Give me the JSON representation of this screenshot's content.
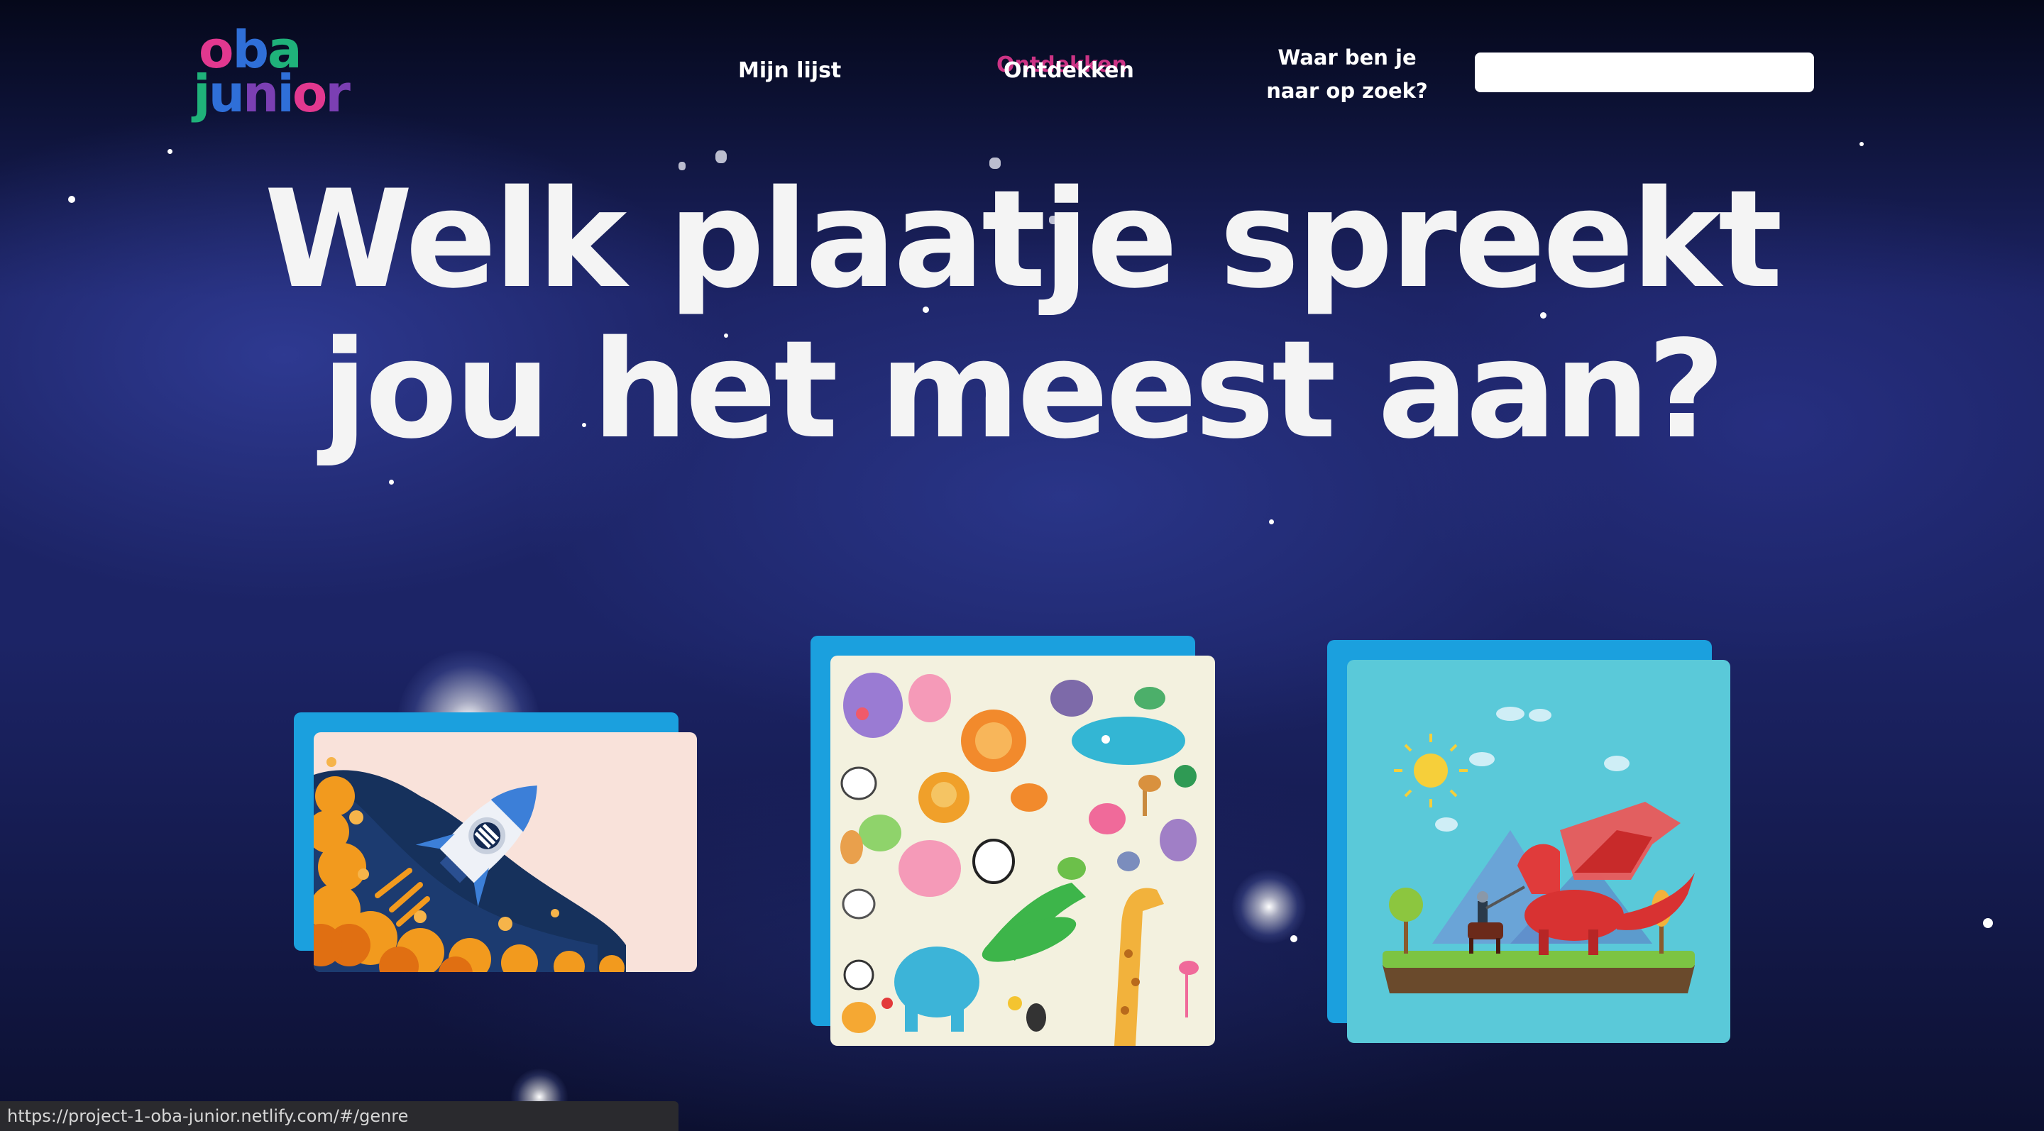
{
  "header": {
    "logo_top": "oba",
    "logo_bottom": "junior",
    "nav": [
      {
        "label": "Mijn lijst"
      },
      {
        "label": "Ontdekken"
      }
    ],
    "search": {
      "label": "Waar ben je naar op zoek?",
      "value": "",
      "placeholder": ""
    }
  },
  "main": {
    "title": "Welk plaatje spreekt jou het meest aan?",
    "cards": [
      {
        "name": "rocket",
        "icon": "rocket-illustration"
      },
      {
        "name": "animals",
        "icon": "animals-illustration"
      },
      {
        "name": "dragon",
        "icon": "dragon-knight-illustration"
      }
    ]
  },
  "statusbar": {
    "url": "https://project-1-oba-junior.netlify.com/#/genre"
  },
  "colors": {
    "card_back": "#1ba0de",
    "nav_accent": "#e2388f",
    "logo_o": "#e2388f",
    "logo_b": "#2f6fd8",
    "logo_a": "#1fb27a",
    "logo_junior": "#7b3fb3"
  }
}
